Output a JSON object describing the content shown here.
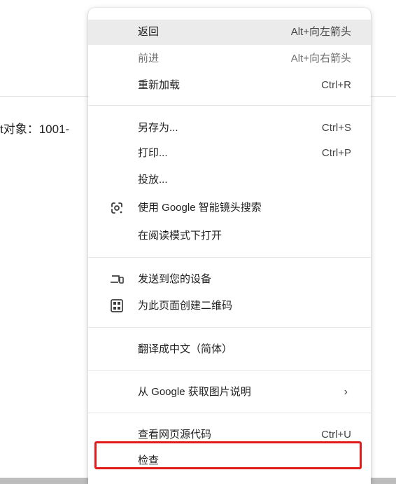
{
  "page": {
    "partial_text": "t对象：1001-"
  },
  "context_menu": {
    "items": [
      {
        "label": "返回",
        "shortcut": "Alt+向左箭头"
      },
      {
        "label": "前进",
        "shortcut": "Alt+向右箭头"
      },
      {
        "label": "重新加载",
        "shortcut": "Ctrl+R"
      },
      {
        "label": "另存为...",
        "shortcut": "Ctrl+S"
      },
      {
        "label": "打印...",
        "shortcut": "Ctrl+P"
      },
      {
        "label": "投放...",
        "shortcut": ""
      },
      {
        "label": "使用 Google 智能镜头搜索",
        "shortcut": "",
        "icon": "google-lens-icon"
      },
      {
        "label": "在阅读模式下打开",
        "shortcut": ""
      },
      {
        "label": "发送到您的设备",
        "shortcut": "",
        "icon": "send-to-device-icon"
      },
      {
        "label": "为此页面创建二维码",
        "shortcut": "",
        "icon": "qr-code-icon"
      },
      {
        "label": "翻译成中文（简体）",
        "shortcut": ""
      },
      {
        "label": "从 Google 获取图片说明",
        "shortcut": "",
        "submenu_arrow": "›"
      },
      {
        "label": "查看网页源代码",
        "shortcut": "Ctrl+U"
      },
      {
        "label": "检查",
        "shortcut": ""
      }
    ]
  },
  "colors": {
    "highlight_box": "#e31a1a",
    "hover_background": "#ebebeb"
  }
}
